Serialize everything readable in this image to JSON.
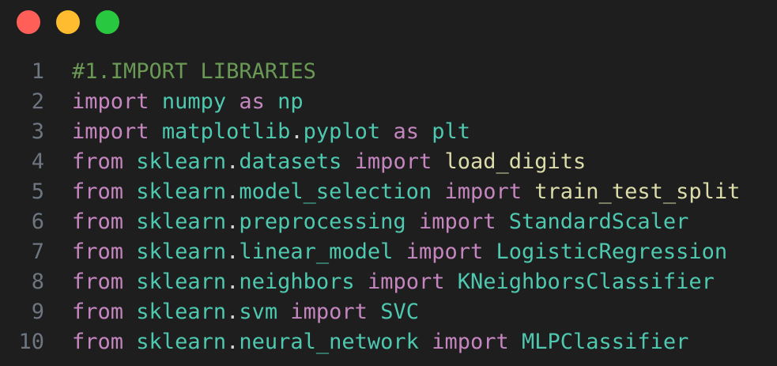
{
  "window": {
    "controls": [
      {
        "name": "close-button",
        "color": "#ff5f57"
      },
      {
        "name": "minimize-button",
        "color": "#febc2e"
      },
      {
        "name": "maximize-button",
        "color": "#28c840"
      }
    ]
  },
  "code": {
    "lines": [
      {
        "number": "1",
        "tokens": [
          {
            "t": "#1.IMPORT LIBRARIES",
            "c": "cm"
          }
        ]
      },
      {
        "number": "2",
        "tokens": [
          {
            "t": "import",
            "c": "kw"
          },
          {
            "t": " ",
            "c": "pl"
          },
          {
            "t": "numpy",
            "c": "md"
          },
          {
            "t": " ",
            "c": "pl"
          },
          {
            "t": "as",
            "c": "kw"
          },
          {
            "t": " ",
            "c": "pl"
          },
          {
            "t": "np",
            "c": "md"
          }
        ]
      },
      {
        "number": "3",
        "tokens": [
          {
            "t": "import",
            "c": "kw"
          },
          {
            "t": " ",
            "c": "pl"
          },
          {
            "t": "matplotlib",
            "c": "md"
          },
          {
            "t": ".",
            "c": "pl"
          },
          {
            "t": "pyplot",
            "c": "md"
          },
          {
            "t": " ",
            "c": "pl"
          },
          {
            "t": "as",
            "c": "kw"
          },
          {
            "t": " ",
            "c": "pl"
          },
          {
            "t": "plt",
            "c": "md"
          }
        ]
      },
      {
        "number": "4",
        "tokens": [
          {
            "t": "from",
            "c": "kw"
          },
          {
            "t": " ",
            "c": "pl"
          },
          {
            "t": "sklearn",
            "c": "md"
          },
          {
            "t": ".",
            "c": "pl"
          },
          {
            "t": "datasets",
            "c": "md"
          },
          {
            "t": " ",
            "c": "pl"
          },
          {
            "t": "import",
            "c": "kw"
          },
          {
            "t": " ",
            "c": "pl"
          },
          {
            "t": "load_digits",
            "c": "fn"
          }
        ]
      },
      {
        "number": "5",
        "tokens": [
          {
            "t": "from",
            "c": "kw"
          },
          {
            "t": " ",
            "c": "pl"
          },
          {
            "t": "sklearn",
            "c": "md"
          },
          {
            "t": ".",
            "c": "pl"
          },
          {
            "t": "model_selection",
            "c": "md"
          },
          {
            "t": " ",
            "c": "pl"
          },
          {
            "t": "import",
            "c": "kw"
          },
          {
            "t": " ",
            "c": "pl"
          },
          {
            "t": "train_test_split",
            "c": "fn"
          }
        ]
      },
      {
        "number": "6",
        "tokens": [
          {
            "t": "from",
            "c": "kw"
          },
          {
            "t": " ",
            "c": "pl"
          },
          {
            "t": "sklearn",
            "c": "md"
          },
          {
            "t": ".",
            "c": "pl"
          },
          {
            "t": "preprocessing",
            "c": "md"
          },
          {
            "t": " ",
            "c": "pl"
          },
          {
            "t": "import",
            "c": "kw"
          },
          {
            "t": " ",
            "c": "pl"
          },
          {
            "t": "StandardScaler",
            "c": "md"
          }
        ]
      },
      {
        "number": "7",
        "tokens": [
          {
            "t": "from",
            "c": "kw"
          },
          {
            "t": " ",
            "c": "pl"
          },
          {
            "t": "sklearn",
            "c": "md"
          },
          {
            "t": ".",
            "c": "pl"
          },
          {
            "t": "linear_model",
            "c": "md"
          },
          {
            "t": " ",
            "c": "pl"
          },
          {
            "t": "import",
            "c": "kw"
          },
          {
            "t": " ",
            "c": "pl"
          },
          {
            "t": "LogisticRegression",
            "c": "md"
          }
        ]
      },
      {
        "number": "8",
        "tokens": [
          {
            "t": "from",
            "c": "kw"
          },
          {
            "t": " ",
            "c": "pl"
          },
          {
            "t": "sklearn",
            "c": "md"
          },
          {
            "t": ".",
            "c": "pl"
          },
          {
            "t": "neighbors",
            "c": "md"
          },
          {
            "t": " ",
            "c": "pl"
          },
          {
            "t": "import",
            "c": "kw"
          },
          {
            "t": " ",
            "c": "pl"
          },
          {
            "t": "KNeighborsClassifier",
            "c": "md"
          }
        ]
      },
      {
        "number": "9",
        "tokens": [
          {
            "t": "from",
            "c": "kw"
          },
          {
            "t": " ",
            "c": "pl"
          },
          {
            "t": "sklearn",
            "c": "md"
          },
          {
            "t": ".",
            "c": "pl"
          },
          {
            "t": "svm",
            "c": "md"
          },
          {
            "t": " ",
            "c": "pl"
          },
          {
            "t": "import",
            "c": "kw"
          },
          {
            "t": " ",
            "c": "pl"
          },
          {
            "t": "SVC",
            "c": "md"
          }
        ]
      },
      {
        "number": "10",
        "tokens": [
          {
            "t": "from",
            "c": "kw"
          },
          {
            "t": " ",
            "c": "pl"
          },
          {
            "t": "sklearn",
            "c": "md"
          },
          {
            "t": ".",
            "c": "pl"
          },
          {
            "t": "neural_network",
            "c": "md"
          },
          {
            "t": " ",
            "c": "pl"
          },
          {
            "t": "import",
            "c": "kw"
          },
          {
            "t": " ",
            "c": "pl"
          },
          {
            "t": "MLPClassifier",
            "c": "md"
          }
        ]
      }
    ]
  }
}
